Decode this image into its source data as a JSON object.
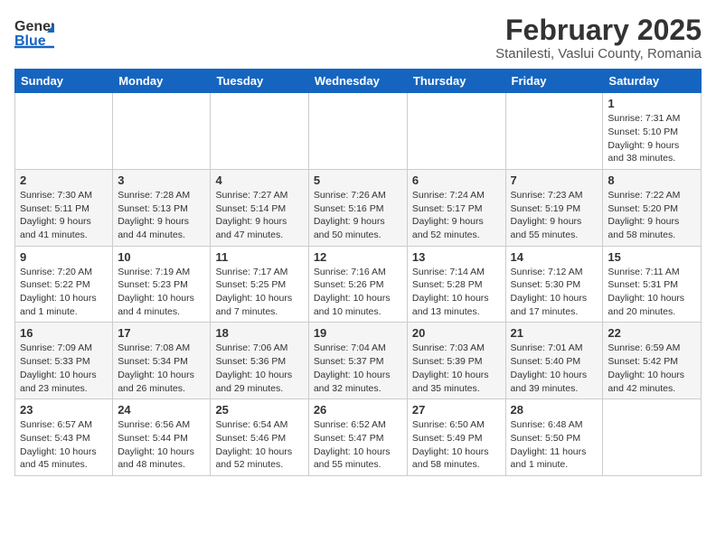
{
  "header": {
    "logo_general": "General",
    "logo_blue": "Blue",
    "month": "February 2025",
    "location": "Stanilesti, Vaslui County, Romania"
  },
  "weekdays": [
    "Sunday",
    "Monday",
    "Tuesday",
    "Wednesday",
    "Thursday",
    "Friday",
    "Saturday"
  ],
  "weeks": [
    [
      {
        "day": "",
        "info": ""
      },
      {
        "day": "",
        "info": ""
      },
      {
        "day": "",
        "info": ""
      },
      {
        "day": "",
        "info": ""
      },
      {
        "day": "",
        "info": ""
      },
      {
        "day": "",
        "info": ""
      },
      {
        "day": "1",
        "info": "Sunrise: 7:31 AM\nSunset: 5:10 PM\nDaylight: 9 hours and 38 minutes."
      }
    ],
    [
      {
        "day": "2",
        "info": "Sunrise: 7:30 AM\nSunset: 5:11 PM\nDaylight: 9 hours and 41 minutes."
      },
      {
        "day": "3",
        "info": "Sunrise: 7:28 AM\nSunset: 5:13 PM\nDaylight: 9 hours and 44 minutes."
      },
      {
        "day": "4",
        "info": "Sunrise: 7:27 AM\nSunset: 5:14 PM\nDaylight: 9 hours and 47 minutes."
      },
      {
        "day": "5",
        "info": "Sunrise: 7:26 AM\nSunset: 5:16 PM\nDaylight: 9 hours and 50 minutes."
      },
      {
        "day": "6",
        "info": "Sunrise: 7:24 AM\nSunset: 5:17 PM\nDaylight: 9 hours and 52 minutes."
      },
      {
        "day": "7",
        "info": "Sunrise: 7:23 AM\nSunset: 5:19 PM\nDaylight: 9 hours and 55 minutes."
      },
      {
        "day": "8",
        "info": "Sunrise: 7:22 AM\nSunset: 5:20 PM\nDaylight: 9 hours and 58 minutes."
      }
    ],
    [
      {
        "day": "9",
        "info": "Sunrise: 7:20 AM\nSunset: 5:22 PM\nDaylight: 10 hours and 1 minute."
      },
      {
        "day": "10",
        "info": "Sunrise: 7:19 AM\nSunset: 5:23 PM\nDaylight: 10 hours and 4 minutes."
      },
      {
        "day": "11",
        "info": "Sunrise: 7:17 AM\nSunset: 5:25 PM\nDaylight: 10 hours and 7 minutes."
      },
      {
        "day": "12",
        "info": "Sunrise: 7:16 AM\nSunset: 5:26 PM\nDaylight: 10 hours and 10 minutes."
      },
      {
        "day": "13",
        "info": "Sunrise: 7:14 AM\nSunset: 5:28 PM\nDaylight: 10 hours and 13 minutes."
      },
      {
        "day": "14",
        "info": "Sunrise: 7:12 AM\nSunset: 5:30 PM\nDaylight: 10 hours and 17 minutes."
      },
      {
        "day": "15",
        "info": "Sunrise: 7:11 AM\nSunset: 5:31 PM\nDaylight: 10 hours and 20 minutes."
      }
    ],
    [
      {
        "day": "16",
        "info": "Sunrise: 7:09 AM\nSunset: 5:33 PM\nDaylight: 10 hours and 23 minutes."
      },
      {
        "day": "17",
        "info": "Sunrise: 7:08 AM\nSunset: 5:34 PM\nDaylight: 10 hours and 26 minutes."
      },
      {
        "day": "18",
        "info": "Sunrise: 7:06 AM\nSunset: 5:36 PM\nDaylight: 10 hours and 29 minutes."
      },
      {
        "day": "19",
        "info": "Sunrise: 7:04 AM\nSunset: 5:37 PM\nDaylight: 10 hours and 32 minutes."
      },
      {
        "day": "20",
        "info": "Sunrise: 7:03 AM\nSunset: 5:39 PM\nDaylight: 10 hours and 35 minutes."
      },
      {
        "day": "21",
        "info": "Sunrise: 7:01 AM\nSunset: 5:40 PM\nDaylight: 10 hours and 39 minutes."
      },
      {
        "day": "22",
        "info": "Sunrise: 6:59 AM\nSunset: 5:42 PM\nDaylight: 10 hours and 42 minutes."
      }
    ],
    [
      {
        "day": "23",
        "info": "Sunrise: 6:57 AM\nSunset: 5:43 PM\nDaylight: 10 hours and 45 minutes."
      },
      {
        "day": "24",
        "info": "Sunrise: 6:56 AM\nSunset: 5:44 PM\nDaylight: 10 hours and 48 minutes."
      },
      {
        "day": "25",
        "info": "Sunrise: 6:54 AM\nSunset: 5:46 PM\nDaylight: 10 hours and 52 minutes."
      },
      {
        "day": "26",
        "info": "Sunrise: 6:52 AM\nSunset: 5:47 PM\nDaylight: 10 hours and 55 minutes."
      },
      {
        "day": "27",
        "info": "Sunrise: 6:50 AM\nSunset: 5:49 PM\nDaylight: 10 hours and 58 minutes."
      },
      {
        "day": "28",
        "info": "Sunrise: 6:48 AM\nSunset: 5:50 PM\nDaylight: 11 hours and 1 minute."
      },
      {
        "day": "",
        "info": ""
      }
    ]
  ]
}
